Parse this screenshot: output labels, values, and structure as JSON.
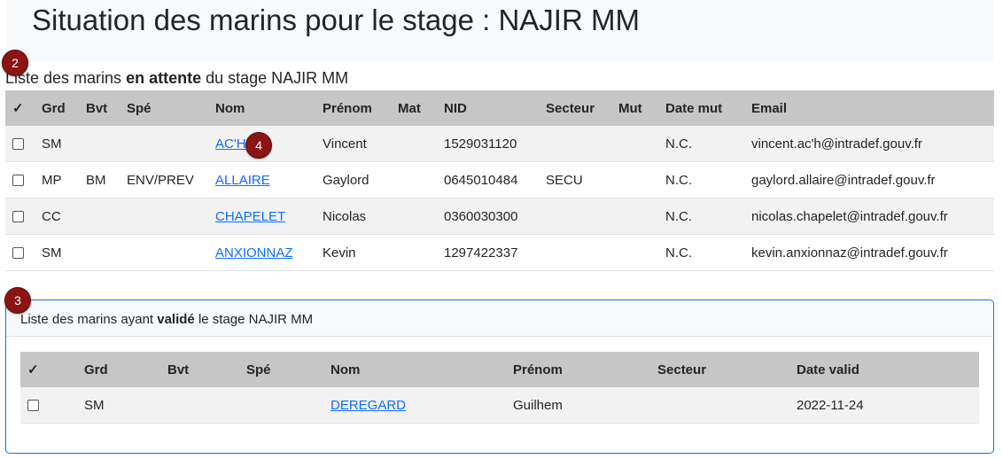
{
  "page": {
    "title": "Situation des marins pour le stage : NAJIR MM"
  },
  "badges": {
    "b2": "2",
    "b3": "3",
    "b4": "4"
  },
  "pending": {
    "title_prefix": "Liste des marins ",
    "title_bold": "en attente",
    "title_suffix": " du stage NAJIR MM",
    "headers": [
      "✓",
      "Grd",
      "Bvt",
      "Spé",
      "Nom",
      "Prénom",
      "Mat",
      "NID",
      "Secteur",
      "Mut",
      "Date mut",
      "Email"
    ],
    "rows": [
      {
        "grd": "SM",
        "bvt": "",
        "spe": "",
        "nom": "AC'H",
        "prenom": "Vincent",
        "mat": "",
        "nid": "1529031120",
        "secteur": "",
        "mut": "",
        "date_mut": "N.C.",
        "email": "vincent.ac'h@intradef.gouv.fr"
      },
      {
        "grd": "MP",
        "bvt": "BM",
        "spe": "ENV/PREV",
        "nom": "ALLAIRE",
        "prenom": "Gaylord",
        "mat": "",
        "nid": "0645010484",
        "secteur": "SECU",
        "mut": "",
        "date_mut": "N.C.",
        "email": "gaylord.allaire@intradef.gouv.fr"
      },
      {
        "grd": "CC",
        "bvt": "",
        "spe": "",
        "nom": "CHAPELET",
        "prenom": "Nicolas",
        "mat": "",
        "nid": "0360030300",
        "secteur": "",
        "mut": "",
        "date_mut": "N.C.",
        "email": "nicolas.chapelet@intradef.gouv.fr"
      },
      {
        "grd": "SM",
        "bvt": "",
        "spe": "",
        "nom": "ANXIONNAZ",
        "prenom": "Kevin",
        "mat": "",
        "nid": "1297422337",
        "secteur": "",
        "mut": "",
        "date_mut": "N.C.",
        "email": "kevin.anxionnaz@intradef.gouv.fr"
      }
    ]
  },
  "validated": {
    "title_prefix": "Liste des marins ayant ",
    "title_bold": "validé",
    "title_suffix": " le stage NAJIR MM",
    "headers": [
      "✓",
      "Grd",
      "Bvt",
      "Spé",
      "Nom",
      "Prénom",
      "Secteur",
      "Date valid"
    ],
    "rows": [
      {
        "grd": "SM",
        "bvt": "",
        "spe": "",
        "nom": "DEREGARD",
        "prenom": "Guilhem",
        "secteur": "",
        "date_valid": "2022-11-24"
      }
    ]
  },
  "colors": {
    "accent": "#0d6efd",
    "badge": "#8b1414",
    "header_bg": "#c6c6c6"
  }
}
